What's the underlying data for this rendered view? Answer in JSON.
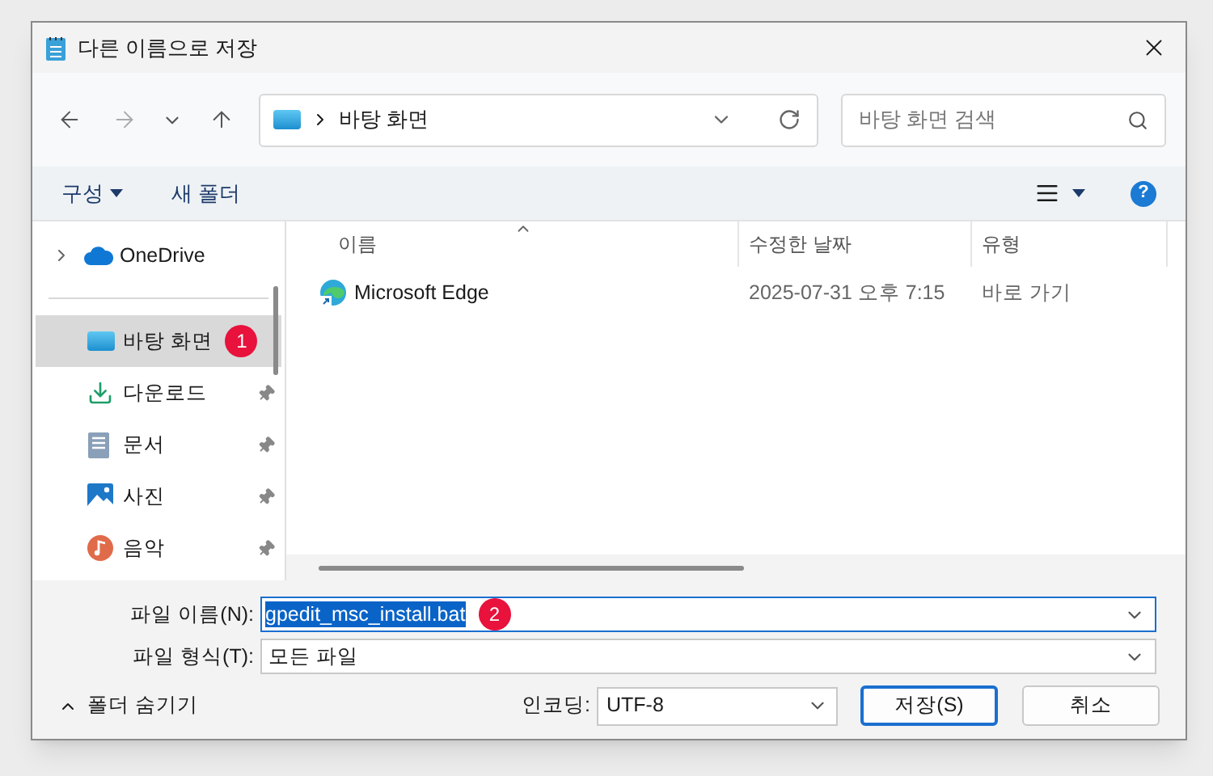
{
  "window": {
    "title": "다른 이름으로 저장"
  },
  "address": {
    "path": "바탕 화면",
    "search_placeholder": "바탕 화면 검색"
  },
  "toolbar": {
    "organize": "구성",
    "new_folder": "새 폴더",
    "help": "?"
  },
  "sidebar": {
    "items": [
      {
        "label": "OneDrive",
        "kind": "cloud",
        "selected": false,
        "pinned": false
      },
      {
        "label": "바탕 화면",
        "kind": "desktop",
        "selected": true,
        "pinned": false,
        "badge": "1"
      },
      {
        "label": "다운로드",
        "kind": "download",
        "selected": false,
        "pinned": true
      },
      {
        "label": "문서",
        "kind": "document",
        "selected": false,
        "pinned": true
      },
      {
        "label": "사진",
        "kind": "picture",
        "selected": false,
        "pinned": true
      },
      {
        "label": "음악",
        "kind": "music",
        "selected": false,
        "pinned": true
      }
    ]
  },
  "table": {
    "columns": [
      "이름",
      "수정한 날짜",
      "유형"
    ],
    "rows": [
      {
        "name": "Microsoft Edge",
        "modified": "2025-07-31 오후 7:15",
        "type": "바로 가기"
      }
    ]
  },
  "form": {
    "filename_label": "파일 이름(N):",
    "filename": "gpedit_msc_install.bat",
    "filename_badge": "2",
    "filetype_label": "파일 형식(T):",
    "filetype": "모든 파일"
  },
  "footer": {
    "hide_folders": "폴더 숨기기",
    "encoding_label": "인코딩:",
    "encoding": "UTF-8",
    "save": "저장(S)",
    "cancel": "취소"
  }
}
